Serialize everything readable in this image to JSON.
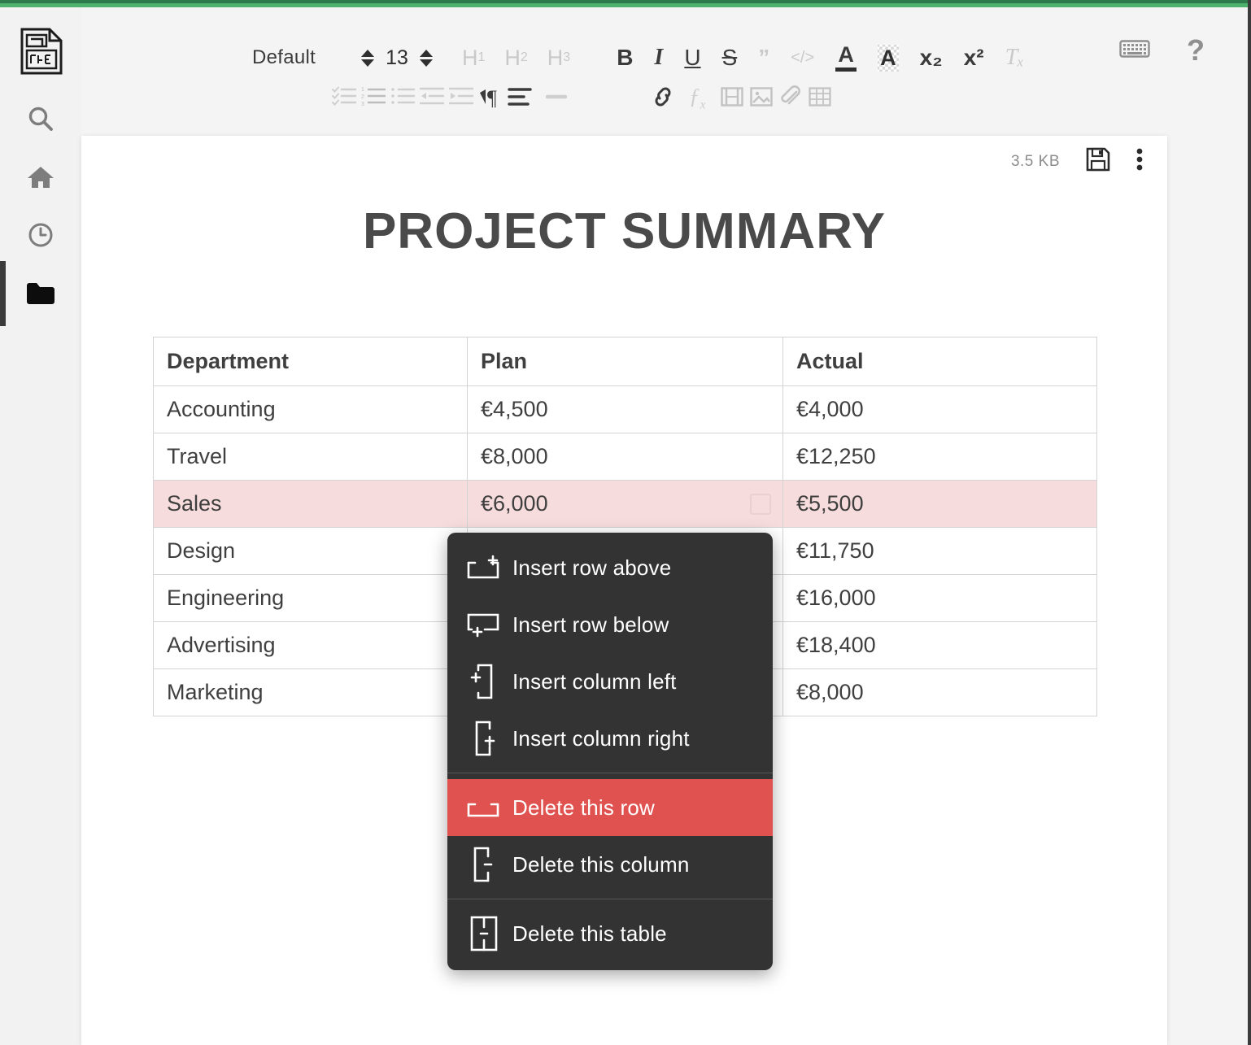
{
  "app": {
    "logo_icon": "document-app-logo-icon",
    "accent_color": "#4cb26e",
    "accent_dark_color": "#2d7a4d"
  },
  "sidebar": {
    "items": [
      {
        "name": "search",
        "icon": "search-icon",
        "active": false
      },
      {
        "name": "home",
        "icon": "home-icon",
        "active": false
      },
      {
        "name": "recent",
        "icon": "clock-icon",
        "active": false
      },
      {
        "name": "files",
        "icon": "folder-icon",
        "active": true
      }
    ]
  },
  "toolbar": {
    "style_select": "Default",
    "font_size": "13",
    "headings": [
      {
        "label": "H",
        "sub": "1"
      },
      {
        "label": "H",
        "sub": "2"
      },
      {
        "label": "H",
        "sub": "3"
      }
    ],
    "format_buttons": [
      {
        "name": "bold",
        "label": "B"
      },
      {
        "name": "italic",
        "label": "I"
      },
      {
        "name": "underline",
        "label": "U"
      },
      {
        "name": "strikethrough",
        "label": "S"
      },
      {
        "name": "blockquote",
        "label": "”"
      },
      {
        "name": "code",
        "label": "</>"
      },
      {
        "name": "text-color",
        "label": "A"
      },
      {
        "name": "highlight-color",
        "label": "A"
      },
      {
        "name": "subscript",
        "label": "x₂"
      },
      {
        "name": "superscript",
        "label": "x²"
      },
      {
        "name": "clear-format",
        "label": "Tₓ"
      }
    ],
    "row2_icons": [
      "checklist-icon",
      "numbered-list-icon",
      "bullet-list-icon",
      "outdent-icon",
      "indent-icon",
      "paragraph-direction-icon",
      "align-icon",
      "horizontal-rule-icon",
      "link-icon",
      "formula-icon",
      "video-icon",
      "image-icon",
      "attachment-icon",
      "table-icon"
    ],
    "right_icons": [
      "keyboard-icon",
      "help-icon"
    ]
  },
  "document": {
    "file_size": "3.5 KB",
    "save_icon": "save-floppy-icon",
    "more_icon": "more-vertical-icon",
    "title": "PROJECT SUMMARY"
  },
  "table": {
    "headers": [
      "Department",
      "Plan",
      "Actual"
    ],
    "rows": [
      {
        "department": "Accounting",
        "plan": "€4,500",
        "actual": "€4,000",
        "highlight": false
      },
      {
        "department": "Travel",
        "plan": "€8,000",
        "actual": "€12,250",
        "highlight": false
      },
      {
        "department": "Sales",
        "plan": "€6,000",
        "actual": "€5,500",
        "highlight": true
      },
      {
        "department": "Design",
        "plan": "",
        "actual": "€11,750",
        "highlight": false
      },
      {
        "department": "Engineering",
        "plan": "",
        "actual": "€16,000",
        "highlight": false
      },
      {
        "department": "Advertising",
        "plan": "",
        "actual": "€18,400",
        "highlight": false
      },
      {
        "department": "Marketing",
        "plan": "",
        "actual": "€8,000",
        "highlight": false
      }
    ],
    "highlight_color": "#f6dcdc"
  },
  "context_menu": {
    "items": [
      {
        "label": "Insert row above",
        "icon": "insert-row-above-icon",
        "danger": false
      },
      {
        "label": "Insert row below",
        "icon": "insert-row-below-icon",
        "danger": false
      },
      {
        "label": "Insert column left",
        "icon": "insert-column-left-icon",
        "danger": false
      },
      {
        "label": "Insert column right",
        "icon": "insert-column-right-icon",
        "danger": false
      },
      {
        "label": "Delete this row",
        "icon": "delete-row-icon",
        "danger": true
      },
      {
        "label": "Delete this column",
        "icon": "delete-column-icon",
        "danger": false
      },
      {
        "label": "Delete this table",
        "icon": "delete-table-icon",
        "danger": false
      }
    ],
    "danger_color": "#e0524f",
    "background_color": "#333333"
  }
}
